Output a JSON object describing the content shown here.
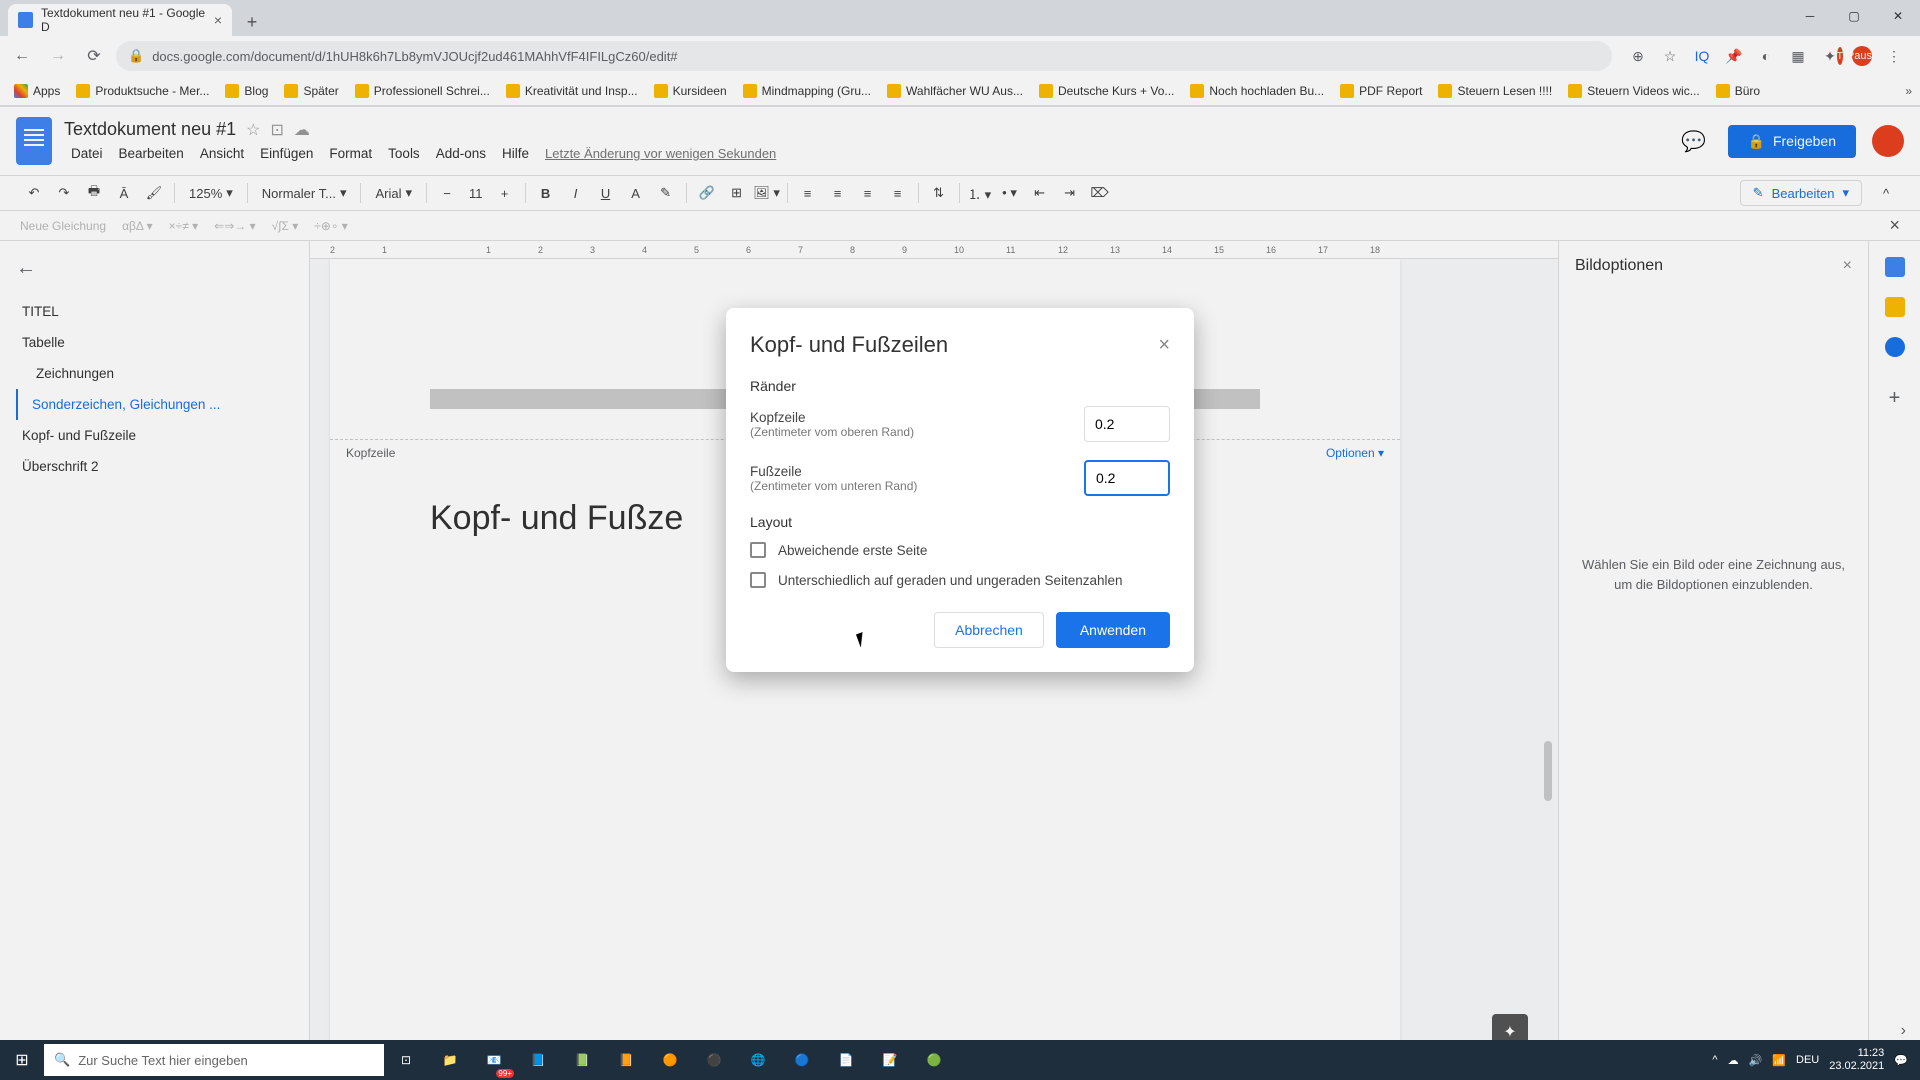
{
  "browser": {
    "tab_title": "Textdokument neu #1 - Google D",
    "url": "docs.google.com/document/d/1hUH8k6h7Lb8ymVJOUcjf2ud461MAhhVfF4IFILgCz60/edit#",
    "profile_status": "Pausiert",
    "bookmarks": {
      "apps": "Apps",
      "items": [
        "Produktsuche - Mer...",
        "Blog",
        "Später",
        "Professionell Schrei...",
        "Kreativität und Insp...",
        "Kursideen",
        "Mindmapping  (Gru...",
        "Wahlfächer WU Aus...",
        "Deutsche Kurs + Vo...",
        "Noch hochladen Bu...",
        "PDF Report",
        "Steuern Lesen !!!!",
        "Steuern Videos wic...",
        "Büro"
      ]
    }
  },
  "docs": {
    "title": "Textdokument neu #1",
    "menus": [
      "Datei",
      "Bearbeiten",
      "Ansicht",
      "Einfügen",
      "Format",
      "Tools",
      "Add-ons",
      "Hilfe"
    ],
    "last_edit": "Letzte Änderung vor wenigen Sekunden",
    "share": "Freigeben",
    "toolbar": {
      "zoom": "125%",
      "style": "Normaler T...",
      "font": "Arial",
      "size": "11",
      "edit_mode": "Bearbeiten"
    },
    "eq_bar": {
      "new": "Neue Gleichung",
      "groups": [
        "αβΔ ▾",
        "×÷≠ ▾",
        "⇐⇒→ ▾",
        "√∫Σ ▾",
        "÷⊕∘ ▾"
      ]
    }
  },
  "outline": {
    "items": [
      {
        "label": "TITEL",
        "level": 0
      },
      {
        "label": "Tabelle",
        "level": 0
      },
      {
        "label": "Zeichnungen",
        "level": 1
      },
      {
        "label": "Sonderzeichen, Gleichungen ...",
        "level": 0,
        "active": true
      },
      {
        "label": "Kopf- und Fußzeile",
        "level": 0
      },
      {
        "label": "Überschrift 2",
        "level": 0
      }
    ]
  },
  "page": {
    "header_label": "Kopfzeile",
    "options": "Optionen ▾",
    "heading": "Kopf- und Fußze"
  },
  "right_panel": {
    "title": "Bildoptionen",
    "empty_text": "Wählen Sie ein Bild oder eine Zeichnung aus, um die Bildoptionen einzublenden."
  },
  "dialog": {
    "title": "Kopf- und Fußzeilen",
    "section_margins": "Ränder",
    "header_label": "Kopfzeile",
    "header_sub": "(Zentimeter vom oberen Rand)",
    "header_value": "0.2",
    "footer_label": "Fußzeile",
    "footer_sub": "(Zentimeter vom unteren Rand)",
    "footer_value": "0.2",
    "section_layout": "Layout",
    "check1": "Abweichende erste Seite",
    "check2": "Unterschiedlich auf geraden und ungeraden Seitenzahlen",
    "cancel": "Abbrechen",
    "apply": "Anwenden"
  },
  "taskbar": {
    "search_placeholder": "Zur Suche Text hier eingeben",
    "time": "11:23",
    "date": "23.02.2021",
    "lang": "DEU",
    "badge": "99+"
  },
  "ruler_ticks": [
    "2",
    "1",
    "",
    "1",
    "2",
    "3",
    "4",
    "5",
    "6",
    "7",
    "8",
    "9",
    "10",
    "11",
    "12",
    "13",
    "14",
    "15",
    "16",
    "17",
    "18"
  ]
}
